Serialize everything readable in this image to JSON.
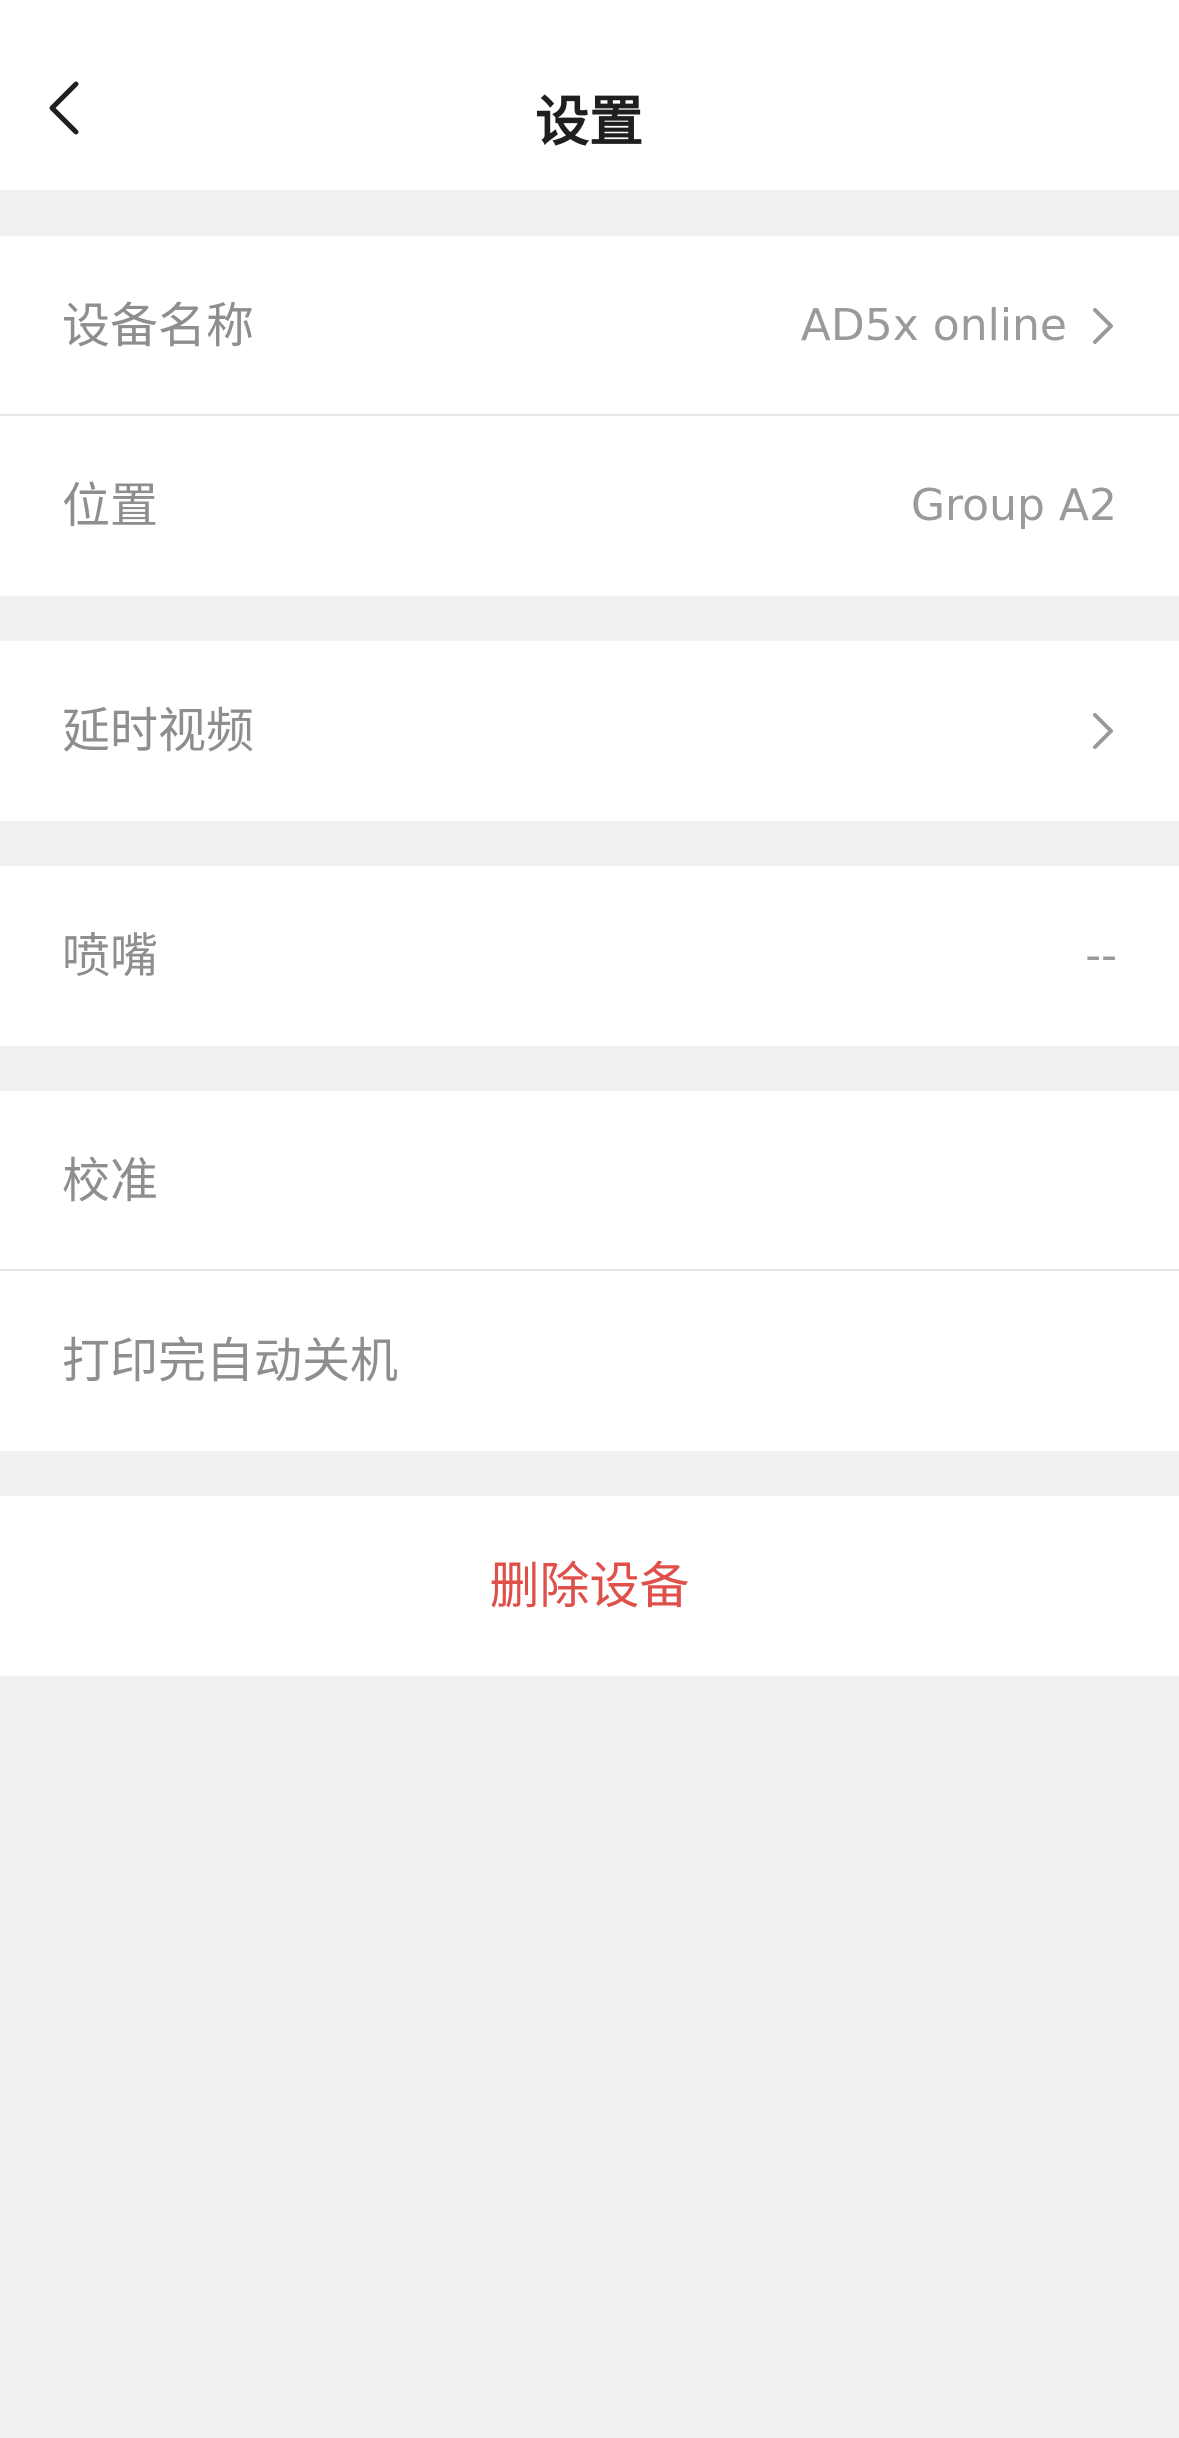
{
  "header": {
    "title": "设置",
    "back_icon": "chevron-left-icon"
  },
  "groups": [
    {
      "rows": [
        {
          "label": "设备名称",
          "value": "AD5x online",
          "chevron": true
        },
        {
          "label": "位置",
          "value": "Group A2",
          "chevron": false
        }
      ]
    },
    {
      "rows": [
        {
          "label": "延时视频",
          "value": "",
          "chevron": true
        }
      ]
    },
    {
      "rows": [
        {
          "label": "喷嘴",
          "value": "--",
          "chevron": false
        }
      ]
    },
    {
      "rows": [
        {
          "label": "校准",
          "value": "",
          "chevron": false
        },
        {
          "label": "打印完自动关机",
          "value": "",
          "chevron": false
        }
      ]
    }
  ],
  "delete_device": {
    "label": "删除设备"
  },
  "colors": {
    "background": "#f0f1f3",
    "danger": "#e0504a",
    "label": "#8e8e8e",
    "title": "#1f1f1f"
  }
}
